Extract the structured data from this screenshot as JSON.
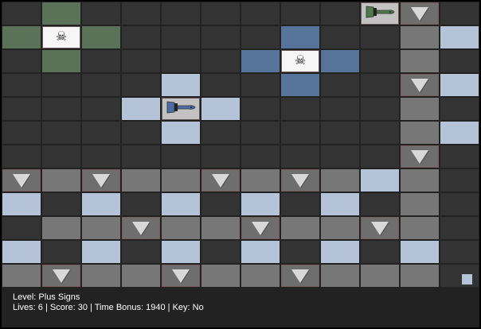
{
  "grid_legend": {
    "d": "empty",
    "g": "green-zone",
    "b": "blue-zone",
    "l": "light-blue-tile",
    "m": "gray-tile",
    "t": "gem-tile",
    "w": "skull-tile",
    "p": "paintbrush-tile",
    "P": "player"
  },
  "grid": [
    [
      "d",
      "g",
      "d",
      "d",
      "d",
      "d",
      "d",
      "d",
      "d",
      "p:green",
      "t",
      "d"
    ],
    [
      "g",
      "w",
      "g",
      "d",
      "d",
      "d",
      "d",
      "b",
      "d",
      "d",
      "m",
      "l"
    ],
    [
      "d",
      "g",
      "d",
      "d",
      "d",
      "d",
      "b",
      "w",
      "b",
      "d",
      "m",
      "d"
    ],
    [
      "d",
      "d",
      "d",
      "d",
      "l",
      "d",
      "d",
      "b",
      "d",
      "d",
      "t",
      "l"
    ],
    [
      "d",
      "d",
      "d",
      "l",
      "p:blue",
      "l",
      "d",
      "d",
      "d",
      "d",
      "m",
      "d"
    ],
    [
      "d",
      "d",
      "d",
      "d",
      "l",
      "d",
      "d",
      "d",
      "d",
      "d",
      "m",
      "l"
    ],
    [
      "d",
      "d",
      "d",
      "d",
      "d",
      "d",
      "d",
      "d",
      "d",
      "d",
      "t",
      "d"
    ],
    [
      "t",
      "m",
      "t",
      "m",
      "m",
      "t",
      "m",
      "t",
      "m",
      "l",
      "m",
      "d"
    ],
    [
      "l",
      "d",
      "l",
      "d",
      "l",
      "d",
      "l",
      "d",
      "l",
      "d",
      "m",
      "d"
    ],
    [
      "d",
      "m",
      "m",
      "t",
      "m",
      "m",
      "t",
      "m",
      "m",
      "t",
      "m",
      "d"
    ],
    [
      "l",
      "d",
      "l",
      "d",
      "l",
      "d",
      "l",
      "d",
      "l",
      "d",
      "l",
      "d"
    ],
    [
      "m",
      "t",
      "m",
      "m",
      "t",
      "m",
      "m",
      "t",
      "m",
      "m",
      "m",
      "P"
    ]
  ],
  "colors": {
    "green_brush": "#4f7a4a",
    "blue_brush": "#4a6fa8"
  },
  "status": {
    "level": "Level: Plus Signs",
    "stats": "Lives: 6 | Score: 30 | Time Bonus: 1940 | Key: No"
  }
}
